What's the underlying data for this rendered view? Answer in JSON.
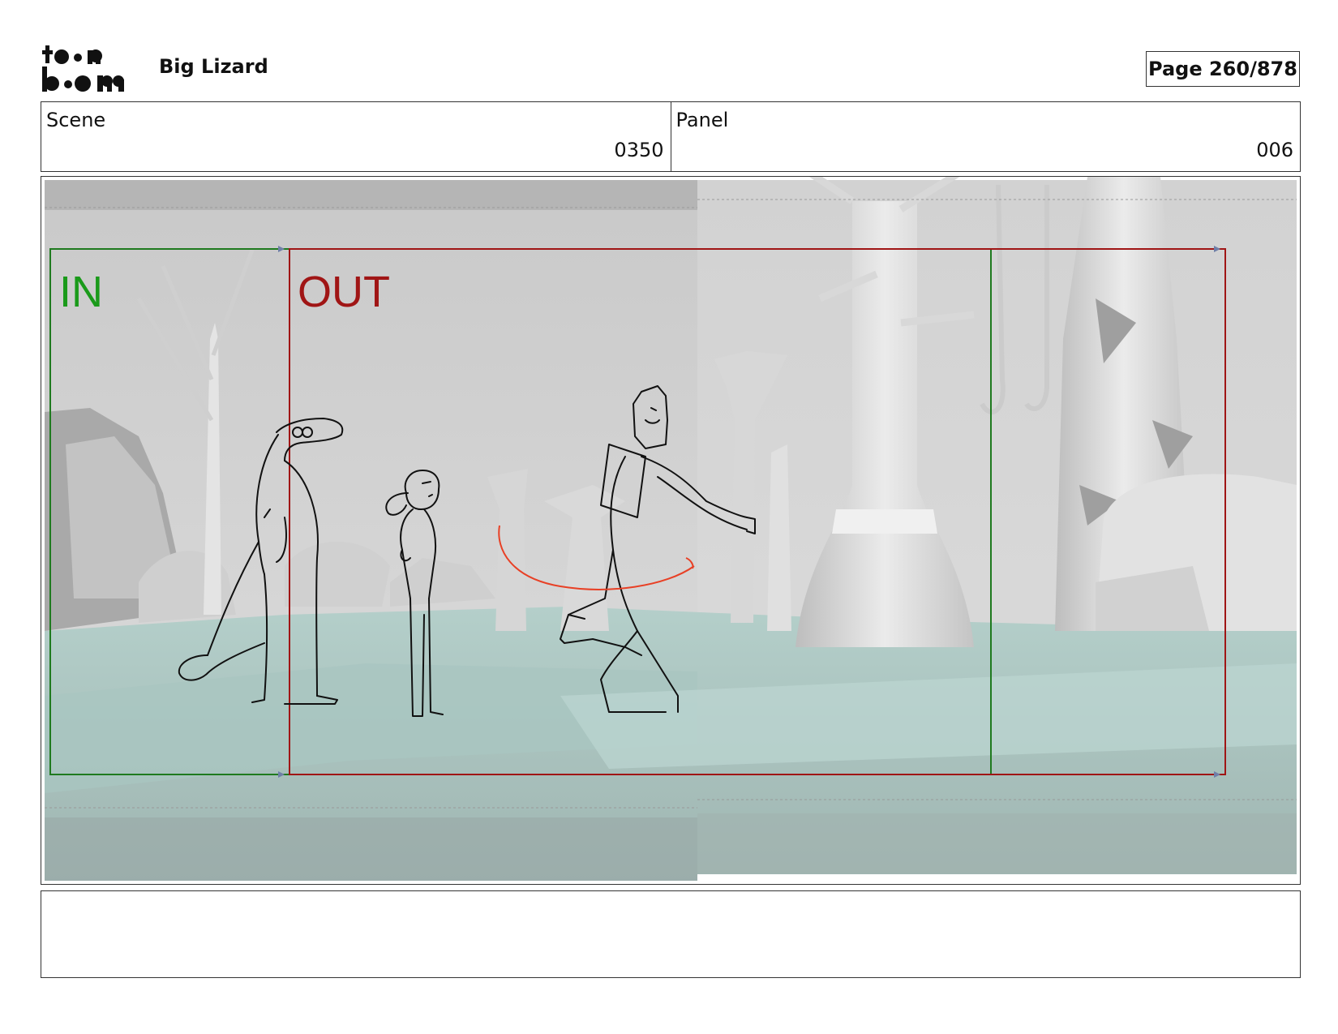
{
  "header": {
    "logo_text": "toon boom",
    "project_title": "Big Lizard",
    "page_label": "Page 260/878"
  },
  "scene": {
    "label": "Scene",
    "value": "0350"
  },
  "panel": {
    "label": "Panel",
    "value": "006"
  },
  "frame": {
    "in_label": "IN",
    "out_label": "OUT",
    "in_color": "#1a9a1a",
    "out_color": "#a01515"
  },
  "notes": {
    "text": ""
  }
}
